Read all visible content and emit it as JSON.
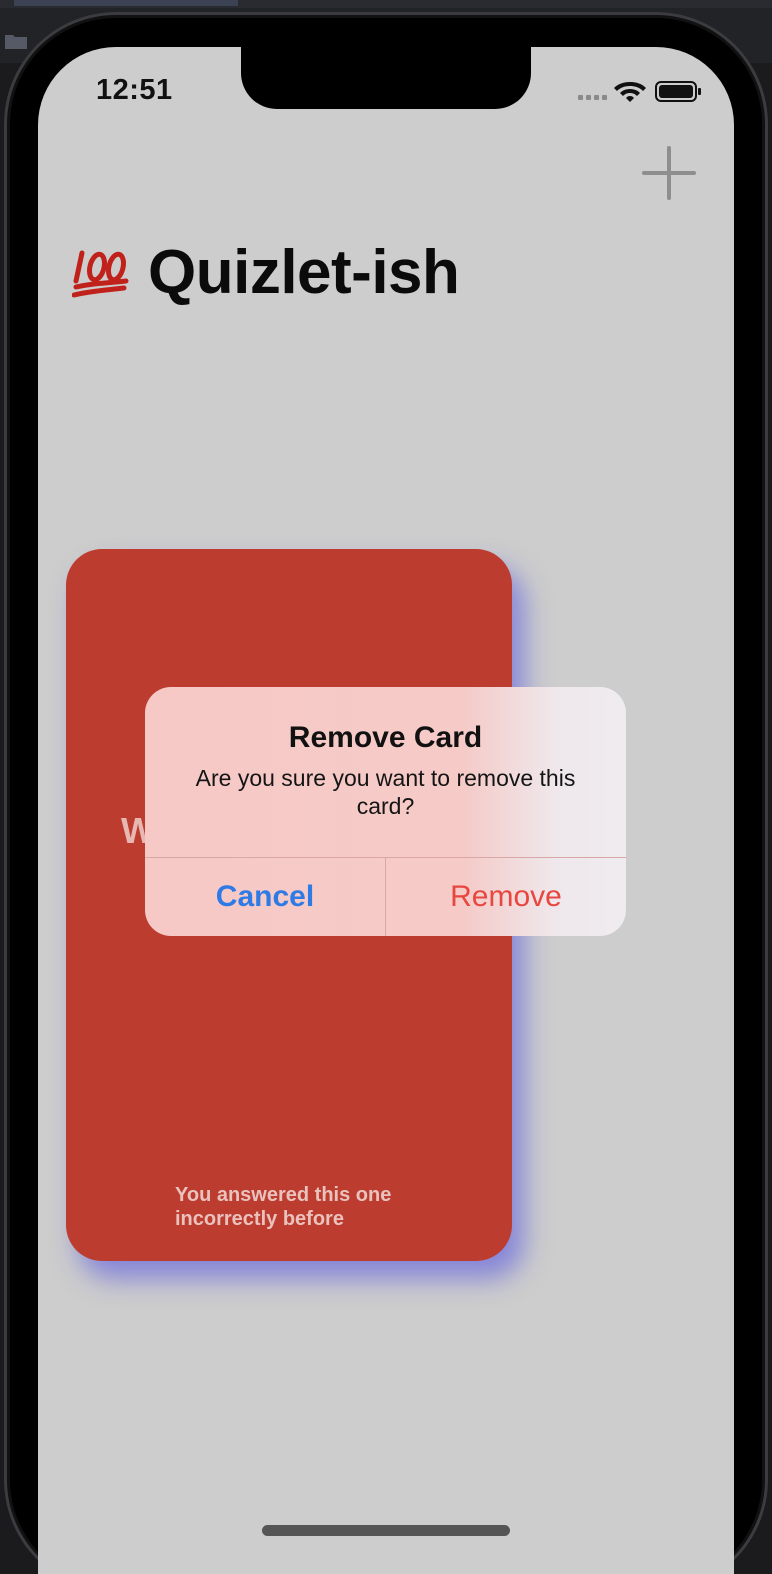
{
  "status_bar": {
    "time": "12:51"
  },
  "nav": {
    "add_icon": "plus-icon"
  },
  "header": {
    "emoji": "💯",
    "title": "Quizlet-ish"
  },
  "card": {
    "question_partial": "W",
    "note": "You answered this one incorrectly before",
    "color": "#bd3c30"
  },
  "alert": {
    "title": "Remove Card",
    "message": "Are you sure you want to remove this card?",
    "cancel_label": "Cancel",
    "remove_label": "Remove",
    "cancel_color": "#2f7be6",
    "remove_color": "#e8473f"
  }
}
